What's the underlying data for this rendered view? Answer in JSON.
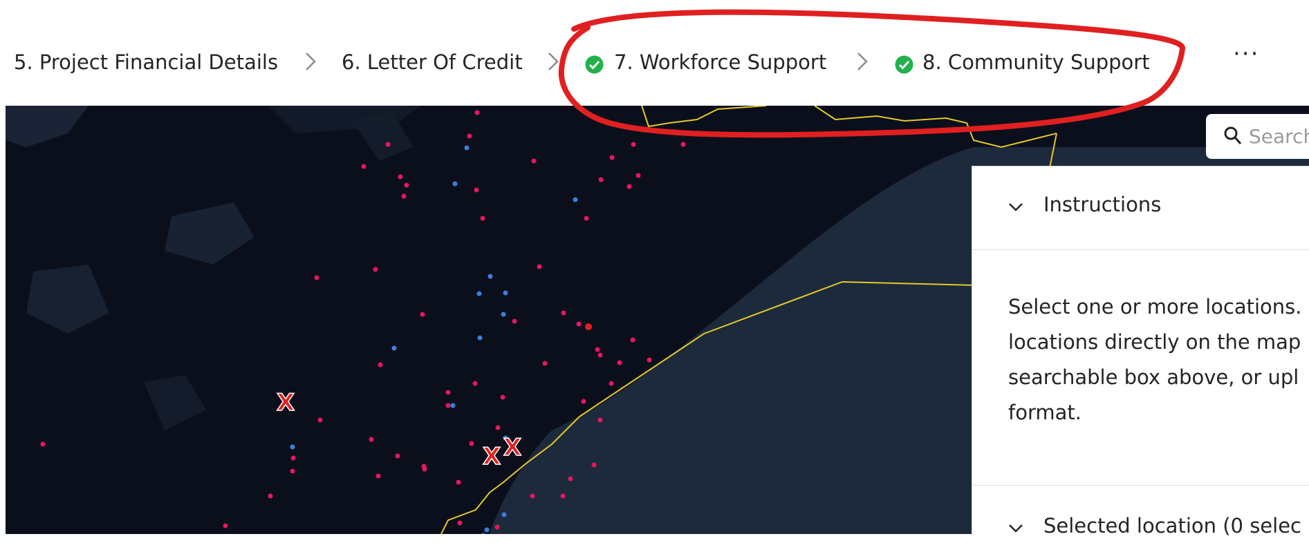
{
  "stepper": {
    "steps": [
      {
        "label": "5. Project Financial Details",
        "complete": false
      },
      {
        "label": "6. Letter Of Credit",
        "complete": false
      },
      {
        "label": "7. Workforce Support",
        "complete": true
      },
      {
        "label": "8. Community Support",
        "complete": true
      }
    ],
    "more_label": "···"
  },
  "map": {
    "search_placeholder": "Search",
    "markers": [
      {
        "label": "X"
      },
      {
        "label": "X"
      },
      {
        "label": "X"
      }
    ]
  },
  "panel": {
    "instructions_title": "Instructions",
    "instructions_text": "Select one or more locations.\nlocations directly on the map\nsearchable box above, or upl\nformat.",
    "selected_title": "Selected location (0 selec"
  },
  "colors": {
    "check": "#22b04b",
    "annotation": "#e02020",
    "border_yellow": "#e5c92b",
    "dot_pink": "#e8165d",
    "dot_blue": "#3a7fe0",
    "map_bg": "#0b0f1c"
  },
  "icons": [
    "chevron-right-icon",
    "check-circle-icon",
    "more-icon",
    "search-icon",
    "chevron-down-icon"
  ]
}
